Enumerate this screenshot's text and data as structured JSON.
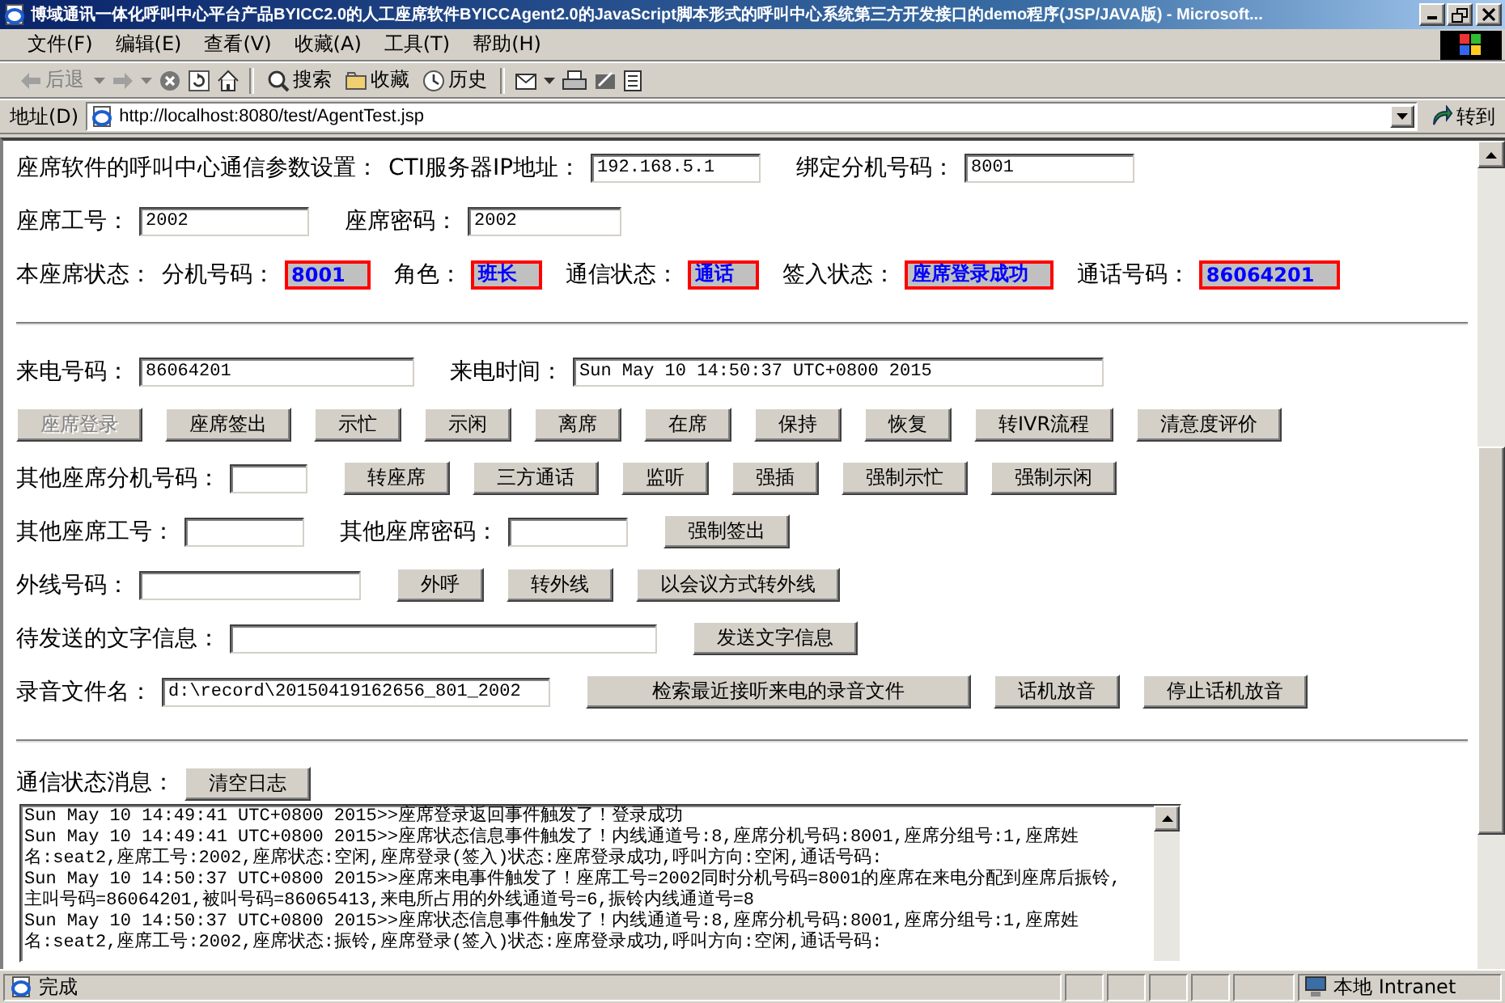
{
  "window": {
    "title": "博域通讯一体化呼叫中心平台产品BYICC2.0的人工座席软件BYICCAgent2.0的JavaScript脚本形式的呼叫中心系统第三方开发接口的demo程序(JSP/JAVA版) - Microsoft..."
  },
  "menu": [
    "文件(F)",
    "编辑(E)",
    "查看(V)",
    "收藏(A)",
    "工具(T)",
    "帮助(H)"
  ],
  "toolbar": {
    "back": {
      "label": "后退",
      "disabled": true
    },
    "search": "搜索",
    "favorites": "收藏",
    "history": "历史"
  },
  "address_bar": {
    "label": "地址(D)",
    "url": "http://localhost:8080/test/AgentTest.jsp",
    "go": "转到"
  },
  "form": {
    "rows": [
      {
        "kind": "fields",
        "items": [
          {
            "kind": "label",
            "text": "座席软件的呼叫中心通信参数设置："
          },
          {
            "kind": "label",
            "text": "CTI服务器IP地址："
          },
          {
            "kind": "field",
            "value": "192.168.5.1"
          },
          {
            "kind": "label",
            "text": "绑定分机号码："
          },
          {
            "kind": "field",
            "value": "8001"
          }
        ]
      },
      {
        "kind": "fields",
        "items": [
          {
            "kind": "label",
            "text": "座席工号："
          },
          {
            "kind": "field",
            "value": "2002"
          },
          {
            "kind": "label",
            "text": "座席密码："
          },
          {
            "kind": "field",
            "value": "2002"
          }
        ]
      },
      {
        "kind": "fields",
        "items": [
          {
            "kind": "label",
            "text": "本座席状态："
          },
          {
            "kind": "label",
            "text": "分机号码："
          },
          {
            "kind": "status",
            "value": "8001"
          },
          {
            "kind": "label",
            "text": "角色："
          },
          {
            "kind": "status",
            "value": "班长"
          },
          {
            "kind": "label",
            "text": "通信状态："
          },
          {
            "kind": "status",
            "value": "通话"
          },
          {
            "kind": "label",
            "text": "签入状态："
          },
          {
            "kind": "status",
            "value": "座席登录成功"
          },
          {
            "kind": "label",
            "text": "通话号码："
          },
          {
            "kind": "status",
            "value": "86064201"
          }
        ]
      },
      {
        "kind": "divider"
      },
      {
        "kind": "fields",
        "items": [
          {
            "kind": "label",
            "text": "来电号码："
          },
          {
            "kind": "field",
            "value": "86064201"
          },
          {
            "kind": "label",
            "text": "来电时间："
          },
          {
            "kind": "field",
            "value": "Sun May 10 14:50:37 UTC+0800 2015"
          }
        ]
      },
      {
        "kind": "fields",
        "items": [
          {
            "kind": "button",
            "label": "座席登录",
            "disabled": true
          },
          {
            "kind": "button",
            "label": "座席签出",
            "disabled": false
          },
          {
            "kind": "button",
            "label": "示忙",
            "disabled": false
          },
          {
            "kind": "button",
            "label": "示闲",
            "disabled": false
          },
          {
            "kind": "button",
            "label": "离席",
            "disabled": false
          },
          {
            "kind": "button",
            "label": "在席",
            "disabled": false
          },
          {
            "kind": "button",
            "label": "保持",
            "disabled": false
          },
          {
            "kind": "button",
            "label": "恢复",
            "disabled": false
          },
          {
            "kind": "button",
            "label": "转IVR流程",
            "disabled": false
          },
          {
            "kind": "button",
            "label": "清意度评价",
            "disabled": false
          }
        ]
      },
      {
        "kind": "fields",
        "items": [
          {
            "kind": "label",
            "text": "其他座席分机号码："
          },
          {
            "kind": "field"
          },
          {
            "kind": "button",
            "label": "转座席",
            "disabled": false
          },
          {
            "kind": "button",
            "label": "三方通话",
            "disabled": false
          },
          {
            "kind": "button",
            "label": "监听",
            "disabled": false
          },
          {
            "kind": "button",
            "label": "强插",
            "disabled": false
          },
          {
            "kind": "button",
            "label": "强制示忙",
            "disabled": false
          },
          {
            "kind": "button",
            "label": "强制示闲",
            "disabled": false
          }
        ]
      },
      {
        "kind": "fields",
        "items": [
          {
            "kind": "label",
            "text": "其他座席工号："
          },
          {
            "kind": "field"
          },
          {
            "kind": "label",
            "text": "其他座席密码："
          },
          {
            "kind": "field"
          },
          {
            "kind": "button",
            "label": "强制签出",
            "disabled": false
          }
        ]
      },
      {
        "kind": "fields",
        "items": [
          {
            "kind": "label",
            "text": "外线号码："
          },
          {
            "kind": "field"
          },
          {
            "kind": "button",
            "label": "外呼",
            "disabled": false
          },
          {
            "kind": "button",
            "label": "转外线",
            "disabled": false
          },
          {
            "kind": "button",
            "label": "以会议方式转外线",
            "disabled": false
          }
        ]
      },
      {
        "kind": "fields",
        "items": [
          {
            "kind": "label",
            "text": "待发送的文字信息："
          },
          {
            "kind": "field"
          },
          {
            "kind": "button",
            "label": "发送文字信息",
            "disabled": false
          }
        ]
      },
      {
        "kind": "fields",
        "items": [
          {
            "kind": "label",
            "text": "录音文件名："
          },
          {
            "kind": "field",
            "value": "d:\\record\\20150419162656_801_2002"
          },
          {
            "kind": "button",
            "label": "检索最近接听来电的录音文件",
            "disabled": false
          },
          {
            "kind": "button",
            "label": "话机放音",
            "disabled": false
          },
          {
            "kind": "button",
            "label": "停止话机放音",
            "disabled": false
          }
        ]
      },
      {
        "kind": "divider"
      },
      {
        "kind": "fields",
        "items": [
          {
            "kind": "label",
            "text": "通信状态消息："
          },
          {
            "kind": "button",
            "label": "清空日志",
            "disabled": false
          }
        ]
      }
    ]
  },
  "log": [
    "Sun May 10 14:49:41 UTC+0800 2015>>座席登录返回事件触发了！登录成功",
    "Sun May 10 14:49:41 UTC+0800 2015>>座席状态信息事件触发了！内线通道号:8,座席分机号码:8001,座席分组号:1,座席姓",
    "名:seat2,座席工号:2002,座席状态:空闲,座席登录(签入)状态:座席登录成功,呼叫方向:空闲,通话号码:",
    "Sun May 10 14:50:37 UTC+0800 2015>>座席来电事件触发了！座席工号=2002同时分机号码=8001的座席在来电分配到座席后振铃,",
    "主叫号码=86064201,被叫号码=86065413,来电所占用的外线通道号=6,振铃内线通道号=8",
    "Sun May 10 14:50:37 UTC+0800 2015>>座席状态信息事件触发了！内线通道号:8,座席分机号码:8001,座席分组号:1,座席姓",
    "名:seat2,座席工号:2002,座席状态:振铃,座席登录(签入)状态:座席登录成功,呼叫方向:空闲,通话号码:"
  ],
  "status_bar": {
    "text": "完成",
    "zone": "本地 Intranet"
  }
}
